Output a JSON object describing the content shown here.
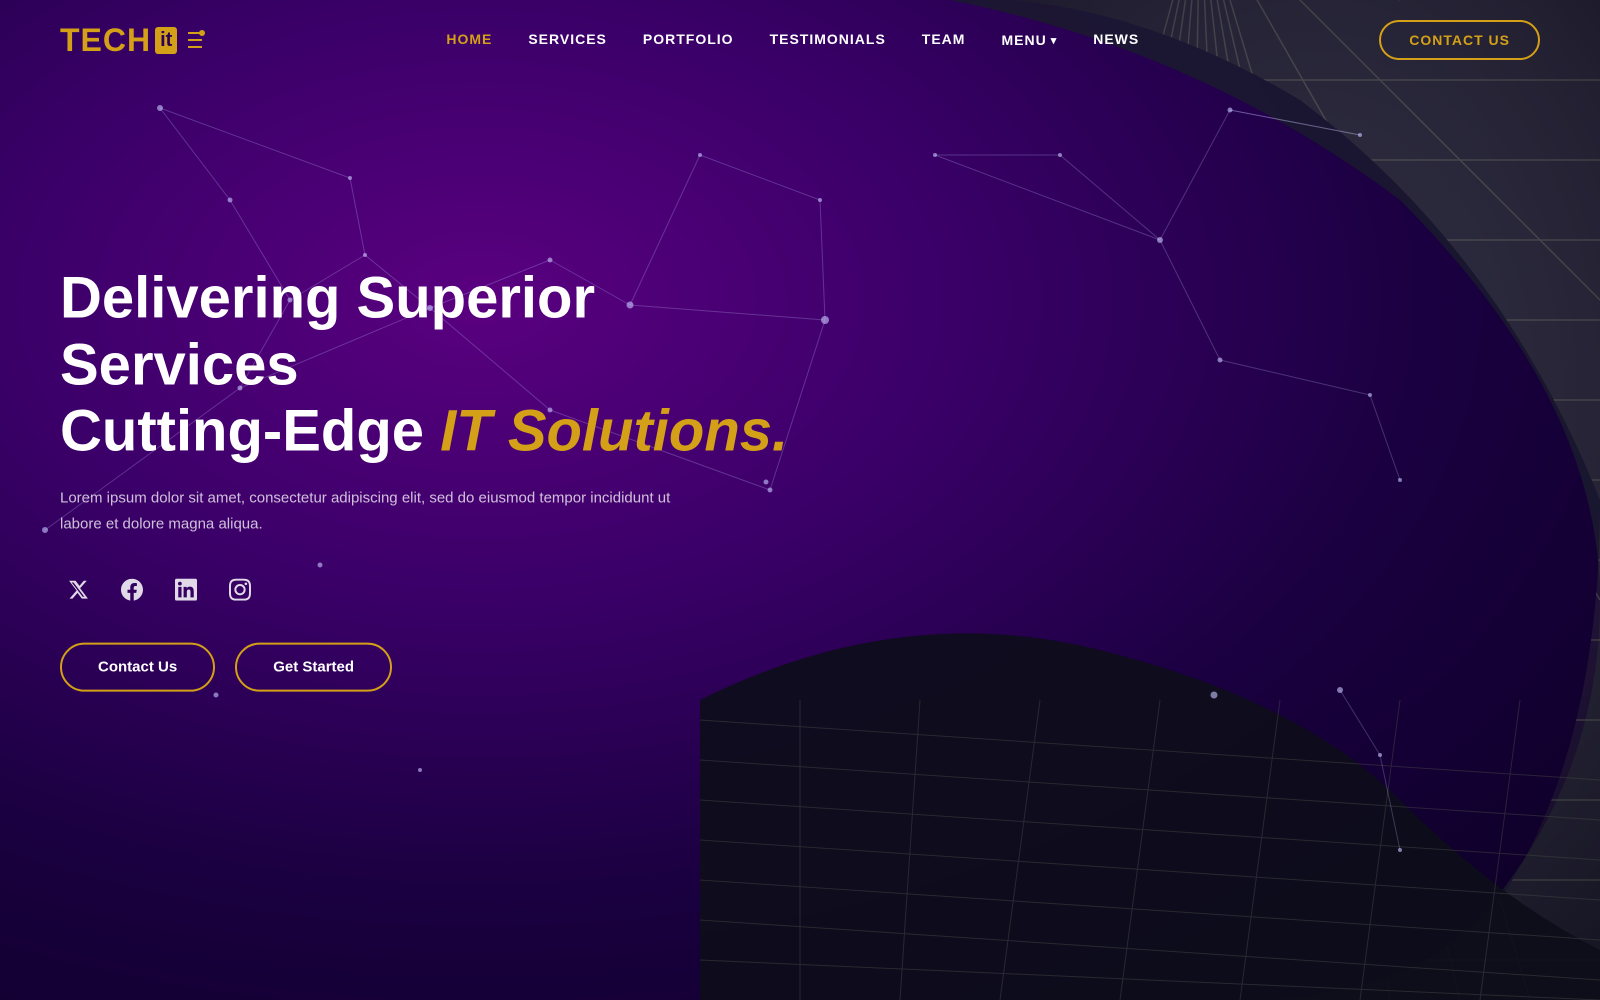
{
  "site": {
    "logo": {
      "tech": "TECH",
      "it": "it",
      "bracket": "⠿"
    }
  },
  "navbar": {
    "links": [
      {
        "label": "HOME",
        "active": true,
        "id": "home"
      },
      {
        "label": "SERVICES",
        "active": false,
        "id": "services"
      },
      {
        "label": "PORTFOLIO",
        "active": false,
        "id": "portfolio"
      },
      {
        "label": "TESTIMONIALS",
        "active": false,
        "id": "testimonials"
      },
      {
        "label": "TEAM",
        "active": false,
        "id": "team"
      },
      {
        "label": "MENU",
        "active": false,
        "id": "menu",
        "hasDropdown": true
      },
      {
        "label": "NEWS",
        "active": false,
        "id": "news"
      }
    ],
    "contact_button": "Contact Us"
  },
  "hero": {
    "title_line1": "Delivering Superior Services",
    "title_line2_plain": "Cutting-Edge ",
    "title_line2_highlight": "IT Solutions.",
    "description": "Lorem ipsum dolor sit amet, consectetur adipiscing elit, sed do eiusmod tempor incididunt ut labore et dolore magna aliqua.",
    "cta_contact": "Contact Us",
    "cta_started": "Get Started"
  },
  "social": [
    {
      "name": "twitter",
      "icon": "𝕏"
    },
    {
      "name": "facebook",
      "icon": "f"
    },
    {
      "name": "linkedin",
      "icon": "in"
    },
    {
      "name": "instagram",
      "icon": "◎"
    }
  ],
  "colors": {
    "gold": "#d4a017",
    "purple_dark": "#2a0057",
    "purple_mid": "#5a0080",
    "white": "#ffffff"
  }
}
